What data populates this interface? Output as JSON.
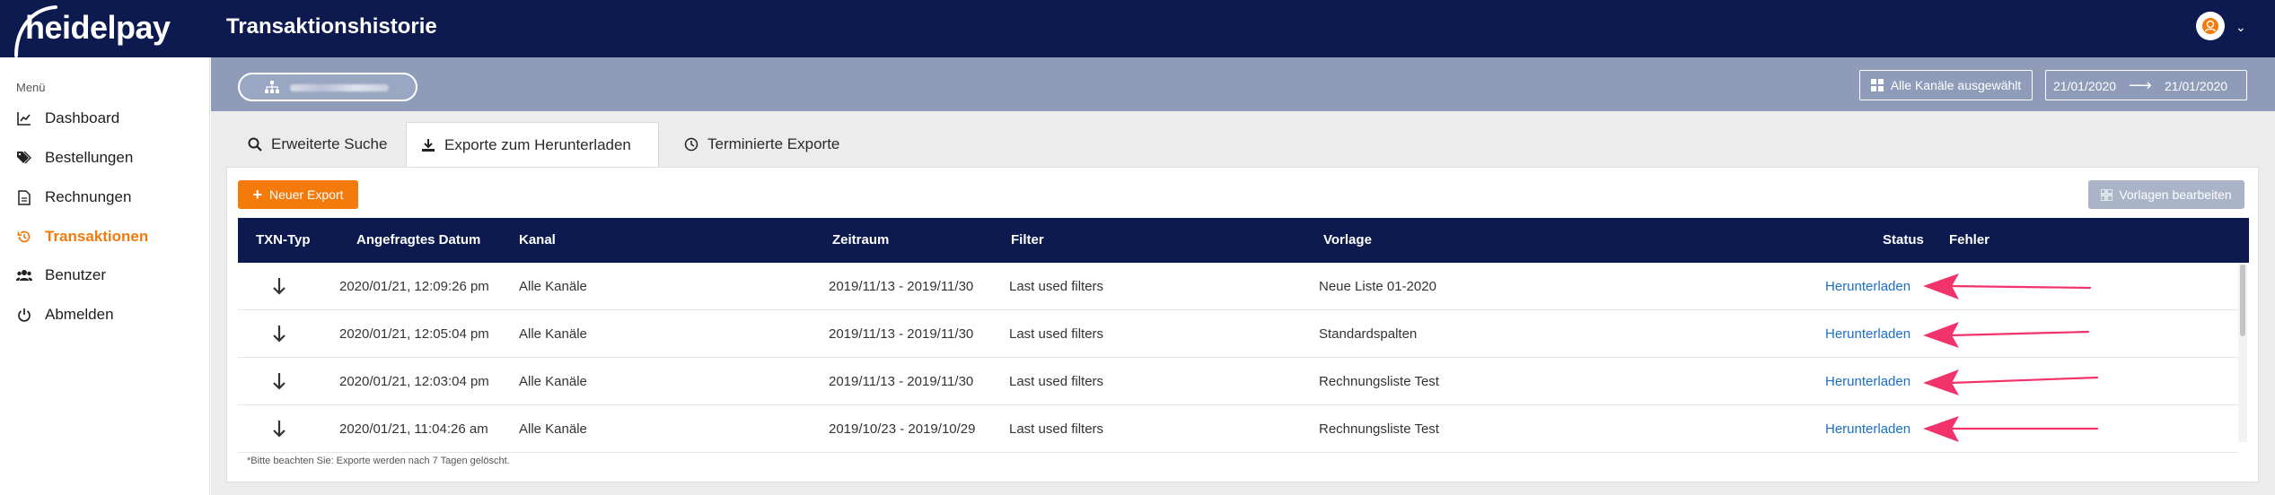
{
  "brand": {
    "logo_text": "heidelpay"
  },
  "header": {
    "title": "Transaktionshistorie",
    "avatar_icon": "user-circle-icon"
  },
  "sidebar": {
    "heading": "Menü",
    "items": [
      {
        "label": "Dashboard",
        "icon": "chart-line-icon",
        "active": false
      },
      {
        "label": "Bestellungen",
        "icon": "tags-icon",
        "active": false
      },
      {
        "label": "Rechnungen",
        "icon": "file-icon",
        "active": false
      },
      {
        "label": "Transaktionen",
        "icon": "history-icon",
        "active": true
      },
      {
        "label": "Benutzer",
        "icon": "users-icon",
        "active": false
      },
      {
        "label": "Abmelden",
        "icon": "power-icon",
        "active": false
      }
    ]
  },
  "filterbar": {
    "merchant": "",
    "channels_label": "Alle Kanäle ausgewählt",
    "date_from": "21/01/2020",
    "date_to": "21/01/2020"
  },
  "tabs": [
    {
      "label": "Erweiterte Suche",
      "icon": "search-icon",
      "active": false
    },
    {
      "label": "Exporte zum Herunterladen",
      "icon": "download-icon",
      "active": true
    },
    {
      "label": "Terminierte Exporte",
      "icon": "clock-icon",
      "active": false
    }
  ],
  "actions": {
    "new_export": "Neuer Export",
    "edit_templates": "Vorlagen bearbeiten"
  },
  "table": {
    "columns": [
      "TXN-Typ",
      "Angefragtes Datum",
      "Kanal",
      "Zeitraum",
      "Filter",
      "Vorlage",
      "Status",
      "Fehler"
    ],
    "rows": [
      {
        "date": "2020/01/21, 12:09:26 pm",
        "channel": "Alle Kanäle",
        "period": "2019/11/13 - 2019/11/30",
        "filter": "Last used filters",
        "template": "Neue Liste 01-2020",
        "status": "Herunterladen"
      },
      {
        "date": "2020/01/21, 12:05:04 pm",
        "channel": "Alle Kanäle",
        "period": "2019/11/13 - 2019/11/30",
        "filter": "Last used filters",
        "template": "Standardspalten",
        "status": "Herunterladen"
      },
      {
        "date": "2020/01/21, 12:03:04 pm",
        "channel": "Alle Kanäle",
        "period": "2019/11/13 - 2019/11/30",
        "filter": "Last used filters",
        "template": "Rechnungsliste Test",
        "status": "Herunterladen"
      },
      {
        "date": "2020/01/21, 11:04:26 am",
        "channel": "Alle Kanäle",
        "period": "2019/10/23 - 2019/10/29",
        "filter": "Last used filters",
        "template": "Rechnungsliste Test",
        "status": "Herunterladen"
      }
    ]
  },
  "footnote": "*Bitte beachten Sie: Exporte werden nach 7 Tagen gelöscht.",
  "colors": {
    "navy": "#0c1a4f",
    "orange": "#f47a0c",
    "link": "#1a6fc9",
    "annotation": "#f2336b"
  }
}
